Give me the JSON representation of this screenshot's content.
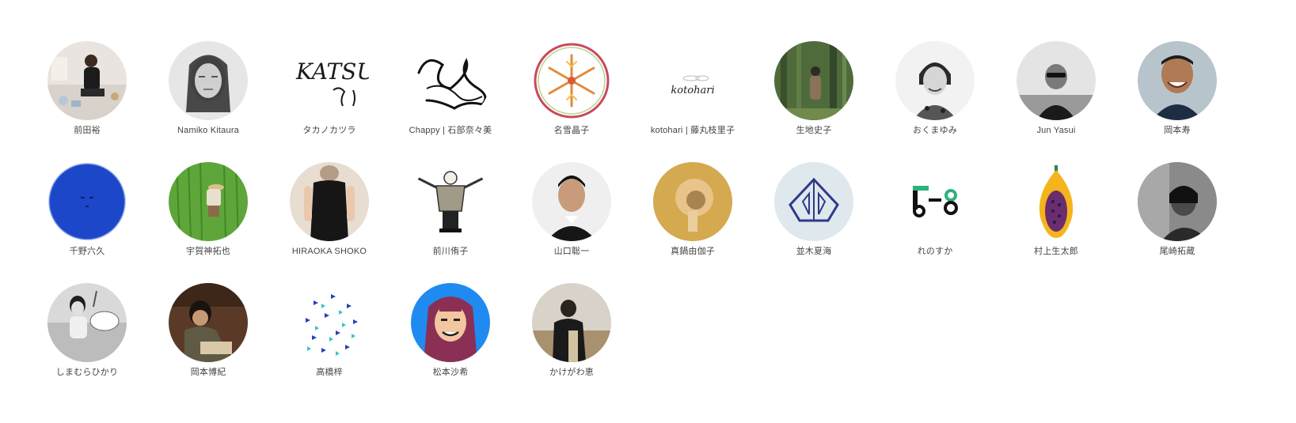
{
  "artists": [
    {
      "name": "前田裕"
    },
    {
      "name": "Namiko Kitaura"
    },
    {
      "name": "タカノカツラ"
    },
    {
      "name": "Chappy | 石部奈々美"
    },
    {
      "name": "名雪晶子"
    },
    {
      "name": "kotohari | 藤丸枝里子"
    },
    {
      "name": "生地史子"
    },
    {
      "name": "おくまゆみ"
    },
    {
      "name": "Jun Yasui"
    },
    {
      "name": "岡本寿"
    },
    {
      "name": "千野六久"
    },
    {
      "name": "宇賀神拓也"
    },
    {
      "name": "HIRAOKA SHOKO"
    },
    {
      "name": "前川侑子"
    },
    {
      "name": "山口聡一"
    },
    {
      "name": "真鍋由伽子"
    },
    {
      "name": "並木夏海"
    },
    {
      "name": "れのすか"
    },
    {
      "name": "村上生太郎"
    },
    {
      "name": "尾崎拓蔵"
    },
    {
      "name": "しまむらひかり"
    },
    {
      "name": "岡本博紀"
    },
    {
      "name": "高橋梓"
    },
    {
      "name": "松本沙希"
    },
    {
      "name": "かけがわ恵"
    }
  ],
  "logo_text": {
    "katsura": "KATSU",
    "kotohari": "kotohari"
  },
  "colors": {
    "label": "#444444",
    "background": "#ffffff"
  }
}
